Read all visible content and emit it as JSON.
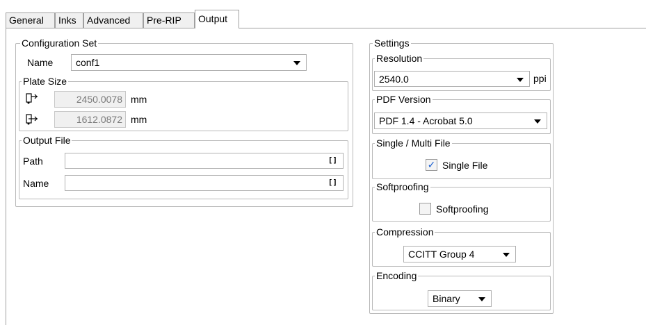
{
  "tabs": [
    {
      "label": "General"
    },
    {
      "label": "Inks"
    },
    {
      "label": "Advanced"
    },
    {
      "label": "Pre-RIP"
    },
    {
      "label": "Output"
    }
  ],
  "configuration_set": {
    "title": "Configuration Set",
    "name_label": "Name",
    "name_value": "conf1",
    "plate_size": {
      "title": "Plate Size",
      "width_value": "2450.0078",
      "height_value": "1612.0872",
      "unit": "mm"
    },
    "output_file": {
      "title": "Output File",
      "path_label": "Path",
      "path_value": "",
      "name_label": "Name",
      "name_value": "",
      "browse_glyph": "[]"
    }
  },
  "settings": {
    "title": "Settings",
    "resolution": {
      "title": "Resolution",
      "value": "2540.0",
      "unit": "ppi"
    },
    "pdf_version": {
      "title": "PDF Version",
      "value": "PDF 1.4 - Acrobat 5.0"
    },
    "single_multi": {
      "title": "Single / Multi File",
      "checkbox_label": "Single File",
      "checked": true
    },
    "softproofing": {
      "title": "Softproofing",
      "checkbox_label": "Softproofing",
      "checked": false
    },
    "compression": {
      "title": "Compression",
      "value": "CCITT Group 4"
    },
    "encoding": {
      "title": "Encoding",
      "value": "Binary"
    }
  },
  "colors": {
    "border": "#a0a0a0",
    "group_border": "#b8b8b8",
    "check_blue": "#1a5fd0",
    "readonly_bg": "#f0f0f0"
  }
}
